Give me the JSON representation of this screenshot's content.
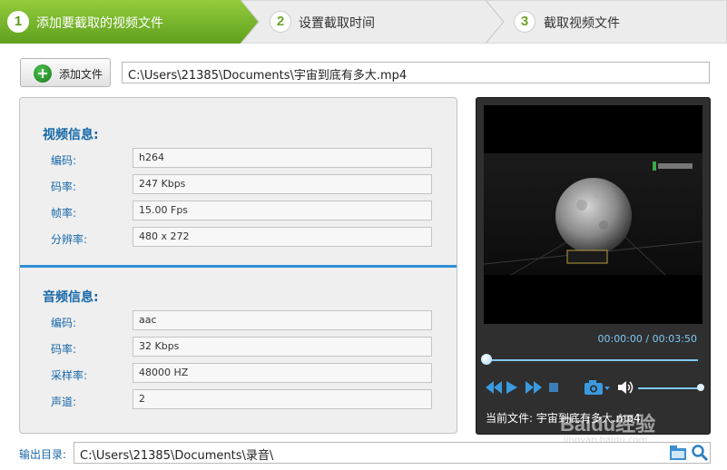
{
  "steps": [
    {
      "number": "1",
      "label": "添加要截取的视频文件",
      "active": true
    },
    {
      "number": "2",
      "label": "设置截取时间",
      "active": false
    },
    {
      "number": "3",
      "label": "截取视频文件",
      "active": false
    }
  ],
  "colors": {
    "active_step": "#7ab82e",
    "inactive_step": "#e8e8e8",
    "accent_blue": "#1667a8",
    "player_blue": "#7fc8f5"
  },
  "toolbar": {
    "add_file_label": "添加文件",
    "add_icon": "plus-circle-icon",
    "file_path": "C:\\Users\\21385\\Documents\\宇宙到底有多大.mp4"
  },
  "video_info": {
    "title": "视频信息:",
    "rows": [
      {
        "label": "编码:",
        "value": "h264"
      },
      {
        "label": "码率:",
        "value": "247 Kbps"
      },
      {
        "label": "帧率:",
        "value": "15.00 Fps"
      },
      {
        "label": "分辨率:",
        "value": "480 x 272"
      }
    ]
  },
  "audio_info": {
    "title": "音频信息:",
    "rows": [
      {
        "label": "编码:",
        "value": "aac"
      },
      {
        "label": "码率:",
        "value": "32 Kbps"
      },
      {
        "label": "采样率:",
        "value": "48000 HZ"
      },
      {
        "label": "声道:",
        "value": "2"
      }
    ]
  },
  "player": {
    "time": "00:00:00 / 00:03:50",
    "progress": 0,
    "volume": 1.0,
    "current_file": "当前文件: 宇宙到底有多大.mp4",
    "controls": [
      "rewind-icon",
      "play-icon",
      "fast-forward-icon",
      "stop-icon",
      "camera-icon",
      "volume-icon"
    ]
  },
  "output": {
    "label": "输出目录:",
    "path": "C:\\Users\\21385\\Documents\\录音\\",
    "folder_icon": "folder-icon",
    "search_icon": "search-icon"
  },
  "watermark": {
    "main": "Baidu经验",
    "sub": "jingyan.baidu.com"
  }
}
